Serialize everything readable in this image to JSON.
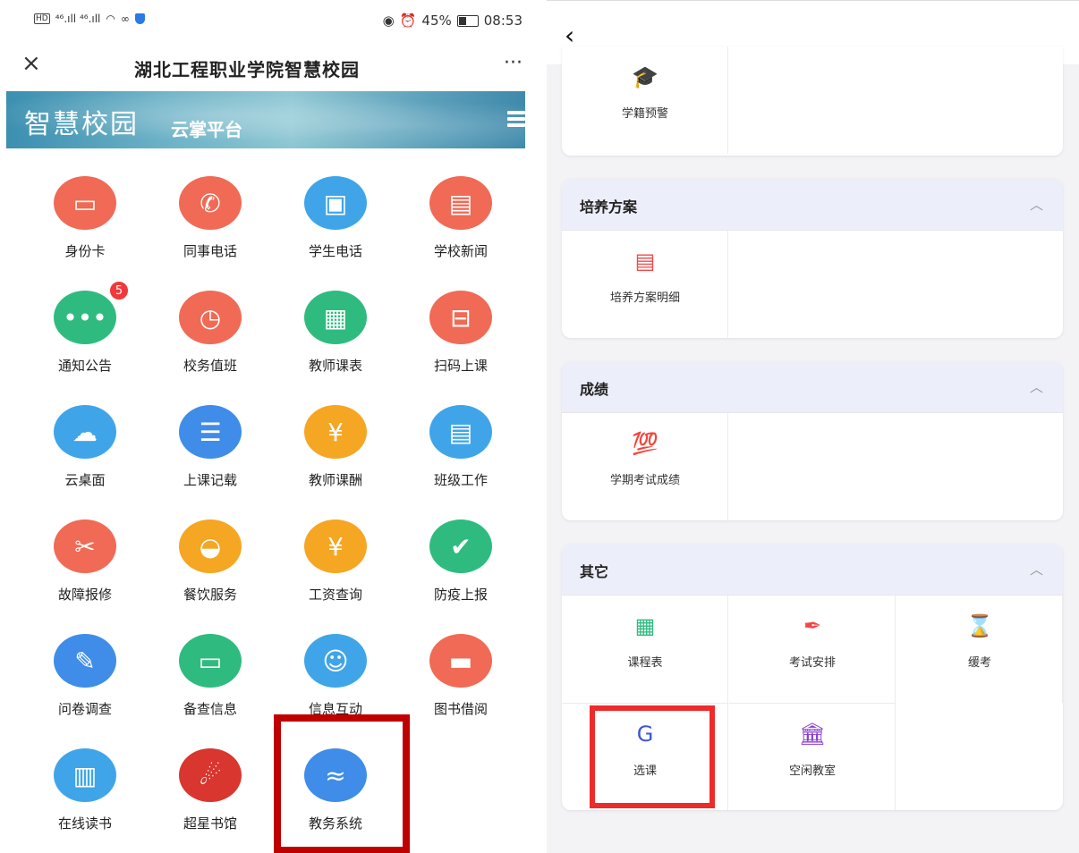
{
  "left": {
    "status_bar": {
      "signal_left": "⁴⁶.ıll ⁴⁶.ıll",
      "battery": "45%",
      "battery_level": 0.45,
      "time": "08:53"
    },
    "title": "湖北工程职业学院智慧校园",
    "close_icon": "×",
    "more_icon": "···",
    "banner": {
      "big": "智慧校园",
      "small": "云掌平台"
    },
    "apps": [
      {
        "label": "身份卡",
        "color": "#f06a55",
        "glyph": "▭"
      },
      {
        "label": "同事电话",
        "color": "#f06a55",
        "glyph": "✆"
      },
      {
        "label": "学生电话",
        "color": "#3fa5e8",
        "glyph": "▣"
      },
      {
        "label": "学校新闻",
        "color": "#f06a55",
        "glyph": "▤"
      },
      {
        "label": "通知公告",
        "color": "#2fbb7f",
        "glyph": "•••",
        "badge": "5"
      },
      {
        "label": "校务值班",
        "color": "#f06a55",
        "glyph": "◷"
      },
      {
        "label": "教师课表",
        "color": "#2fbb7f",
        "glyph": "▦"
      },
      {
        "label": "扫码上课",
        "color": "#f06a55",
        "glyph": "⊟"
      },
      {
        "label": "云桌面",
        "color": "#3fa5e8",
        "glyph": "☁"
      },
      {
        "label": "上课记载",
        "color": "#3f8de8",
        "glyph": "☰"
      },
      {
        "label": "教师课酬",
        "color": "#f5a623",
        "glyph": "¥"
      },
      {
        "label": "班级工作",
        "color": "#3fa5e8",
        "glyph": "▤"
      },
      {
        "label": "故障报修",
        "color": "#f06a55",
        "glyph": "✂"
      },
      {
        "label": "餐饮服务",
        "color": "#f5a623",
        "glyph": "◒"
      },
      {
        "label": "工资查询",
        "color": "#f5a623",
        "glyph": "¥"
      },
      {
        "label": "防疫上报",
        "color": "#2fbb7f",
        "glyph": "✔"
      },
      {
        "label": "问卷调查",
        "color": "#3f8de8",
        "glyph": "✎"
      },
      {
        "label": "备查信息",
        "color": "#2fbb7f",
        "glyph": "▭"
      },
      {
        "label": "信息互动",
        "color": "#3fa5e8",
        "glyph": "☺"
      },
      {
        "label": "图书借阅",
        "color": "#f06a55",
        "glyph": "▬"
      },
      {
        "label": "在线读书",
        "color": "#3fa5e8",
        "glyph": "▥"
      },
      {
        "label": "超星书馆",
        "color": "#d8362e",
        "glyph": "☄"
      },
      {
        "label": "教务系统",
        "color": "#3f8de8",
        "glyph": "≈"
      }
    ]
  },
  "right": {
    "back_icon": "‹",
    "sections": [
      {
        "title": "",
        "items": [
          {
            "label": "学籍预警",
            "glyph": "🎓",
            "color": "#f04848"
          }
        ]
      },
      {
        "title": "培养方案",
        "items": [
          {
            "label": "培养方案明细",
            "glyph": "▤",
            "color": "#f04848"
          }
        ]
      },
      {
        "title": "成绩",
        "items": [
          {
            "label": "学期考试成绩",
            "glyph": "💯",
            "color": "#8a3fd1"
          }
        ]
      },
      {
        "title": "其它",
        "items": [
          {
            "label": "课程表",
            "glyph": "▦",
            "color": "#2fbb7f"
          },
          {
            "label": "考试安排",
            "glyph": "✒",
            "color": "#f04848"
          },
          {
            "label": "缓考",
            "glyph": "⌛",
            "color": "#2fbb7f"
          },
          {
            "label": "选课",
            "glyph": "G",
            "color": "#3f54d8"
          },
          {
            "label": "空闲教室",
            "glyph": "🏛",
            "color": "#8a3fd1"
          }
        ]
      }
    ],
    "collapse_icon": "︿"
  }
}
